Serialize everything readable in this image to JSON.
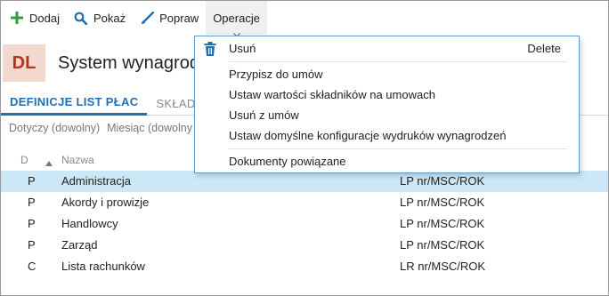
{
  "toolbar": {
    "add_label": "Dodaj",
    "show_label": "Pokaż",
    "edit_label": "Popraw",
    "operations_label": "Operacje"
  },
  "header": {
    "badge": "DL",
    "title": "System wynagrod"
  },
  "tabs": [
    {
      "label": "DEFINICJE LIST PŁAC",
      "active": true
    },
    {
      "label": "SKŁADN",
      "active": false
    }
  ],
  "filters": {
    "dotyczy": "Dotyczy (dowolny)",
    "miesiac": "Miesiąc (dowolny"
  },
  "grid": {
    "columns": {
      "d": "D",
      "name": "Nazwa"
    },
    "rows": [
      {
        "d": "P",
        "name": "Administracja",
        "numbering": "LP nr/MSC/ROK",
        "selected": true
      },
      {
        "d": "P",
        "name": "Akordy i prowizje",
        "numbering": "LP nr/MSC/ROK",
        "selected": false
      },
      {
        "d": "P",
        "name": "Handlowcy",
        "numbering": "LP nr/MSC/ROK",
        "selected": false
      },
      {
        "d": "P",
        "name": "Zarząd",
        "numbering": "LP nr/MSC/ROK",
        "selected": false
      },
      {
        "d": "C",
        "name": "Lista rachunków",
        "numbering": "LR nr/MSC/ROK",
        "selected": false
      }
    ]
  },
  "menu": {
    "items": [
      {
        "label": "Usuń",
        "shortcut": "Delete",
        "icon": "trash-icon"
      },
      {
        "label": "Przypisz do umów"
      },
      {
        "label": "Ustaw wartości składników na umowach"
      },
      {
        "label": "Usuń z umów"
      },
      {
        "label": "Ustaw domyślne konfiguracje wydruków wynagrodzeń"
      },
      {
        "label": "Dokumenty powiązane"
      }
    ]
  },
  "colors": {
    "accent": "#1f6fb5",
    "add_icon": "#2e9e3e",
    "selected_row": "#cce8f6",
    "badge_bg": "#f3d8cf",
    "badge_text": "#b5321f",
    "menu_border": "#5b9bd5"
  }
}
